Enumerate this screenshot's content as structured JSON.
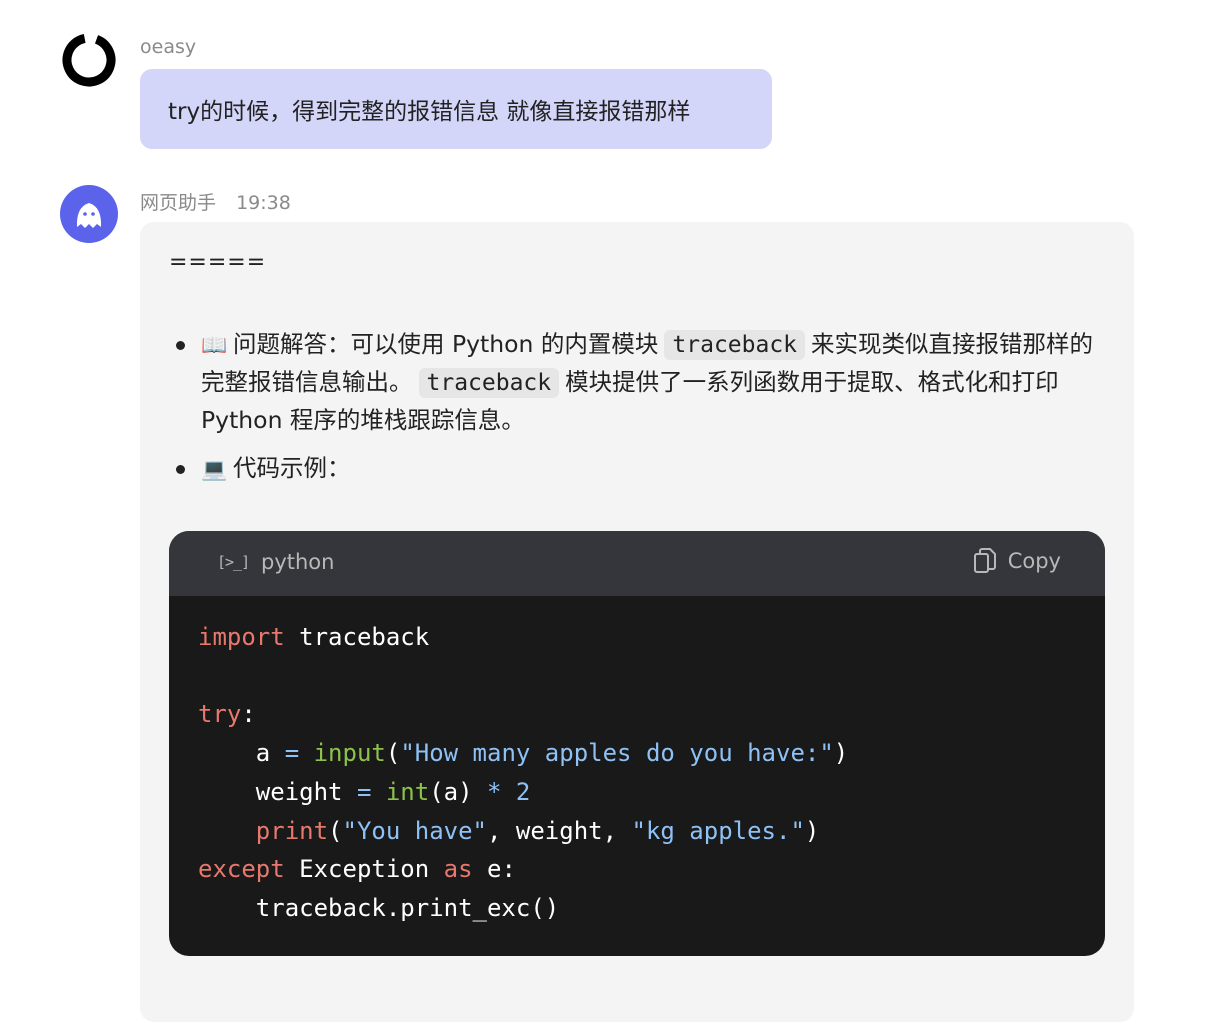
{
  "user_message": {
    "name": "oeasy",
    "text": "try的时候，得到完整的报错信息 就像直接报错那样"
  },
  "bot_message": {
    "name": "网页助手",
    "time": "19:38",
    "divider": "=====",
    "items": [
      {
        "icon": "📖",
        "text_a": "问题解答：可以使用 Python 的内置模块",
        "code_a": "traceback",
        "text_b": "来实现类似直接报错那样的完整报错信息输出。",
        "code_b": "traceback",
        "text_c": "模块提供了一系列函数用于提取、格式化和打印 Python 程序的堆栈跟踪信息。"
      },
      {
        "icon": "💻",
        "text_a": "代码示例："
      }
    ],
    "code_block": {
      "lang_icon": "[>_]",
      "language": "python",
      "copy_label": "Copy"
    }
  },
  "colors": {
    "user_bubble": "#d3d5f9",
    "bot_bubble": "#f4f4f4",
    "code_bg": "#191919",
    "code_header": "#34363b",
    "keyword": "#e8786d",
    "builtin": "#8dc149",
    "string": "#8ec1f5",
    "bot_avatar": "#5a63ea"
  }
}
